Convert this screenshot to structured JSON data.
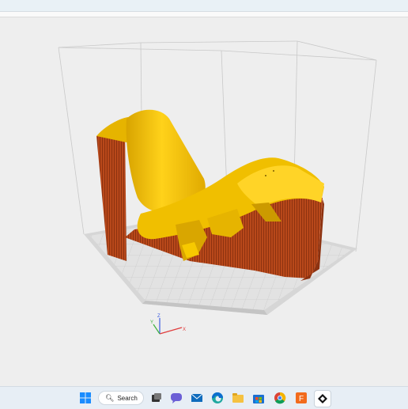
{
  "viewport": {
    "axis_labels": {
      "x": "X",
      "y": "Y",
      "z": "Z"
    },
    "colors": {
      "background": "#eeeeee",
      "bed": "#dddddd",
      "model": "#f5c400",
      "support": "#b8481a"
    }
  },
  "taskbar": {
    "search_label": "Search",
    "icons": [
      "windows-start-icon",
      "search-icon",
      "task-view-icon",
      "chat-icon",
      "mail-icon",
      "edge-browser-icon",
      "file-explorer-icon",
      "microsoft-store-icon",
      "chrome-icon",
      "fusion-app-icon",
      "slicer-app-icon"
    ]
  }
}
